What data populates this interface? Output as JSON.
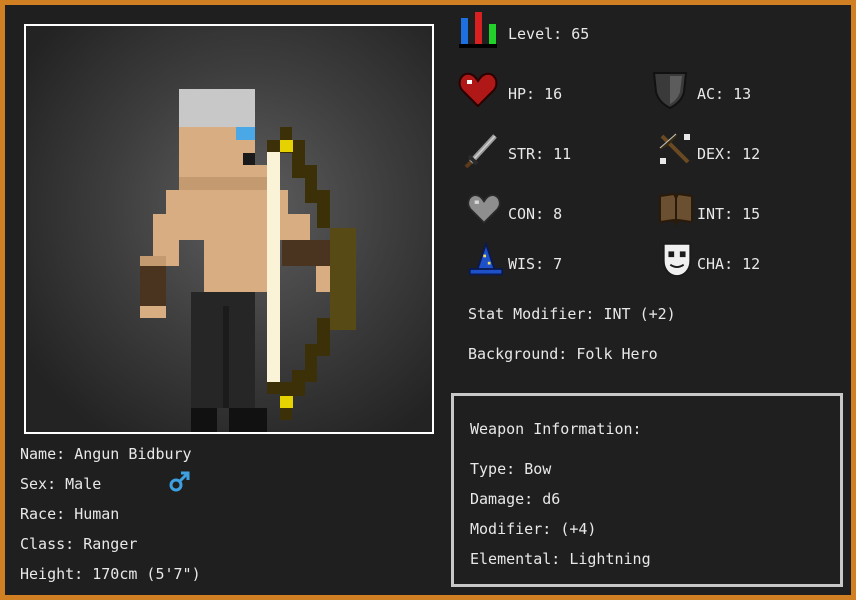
{
  "character": {
    "name_label": "Name:",
    "name": "Angun Bidbury",
    "sex_label": "Sex:",
    "sex": "Male",
    "race_label": "Race:",
    "race": "Human",
    "class_label": "Class:",
    "class": "Ranger",
    "height_label": "Height:",
    "height": "170cm (5'7\")"
  },
  "stats": {
    "level": {
      "label": "Level:",
      "value": "65",
      "icon": "level-bars-icon"
    },
    "hp": {
      "label": "HP:",
      "value": "16",
      "icon": "heart-icon"
    },
    "ac": {
      "label": "AC:",
      "value": "13",
      "icon": "shield-icon"
    },
    "str": {
      "label": "STR:",
      "value": "11",
      "icon": "sword-icon"
    },
    "dex": {
      "label": "DEX:",
      "value": "12",
      "icon": "crossbow-icon"
    },
    "con": {
      "label": "CON:",
      "value": "8",
      "icon": "heart-gray-icon"
    },
    "int": {
      "label": "INT:",
      "value": "15",
      "icon": "book-icon"
    },
    "wis": {
      "label": "WIS:",
      "value": "7",
      "icon": "wizard-hat-icon"
    },
    "cha": {
      "label": "CHA:",
      "value": "12",
      "icon": "mask-icon"
    }
  },
  "stat_modifier": {
    "label": "Stat Modifier:",
    "value": "INT (+2)"
  },
  "background": {
    "label": "Background:",
    "value": "Folk Hero"
  },
  "weapon": {
    "title": "Weapon Information:",
    "type_label": "Type:",
    "type": "Bow",
    "damage_label": "Damage:",
    "damage": "d6",
    "modifier_label": "Modifier:",
    "modifier": "(+4)",
    "elemental_label": "Elemental:",
    "elemental": "Lightning"
  },
  "colors": {
    "frame": "#d07f22",
    "background": "#1f1f1f",
    "text": "#e8e8e8",
    "male_symbol": "#3da0e0"
  }
}
